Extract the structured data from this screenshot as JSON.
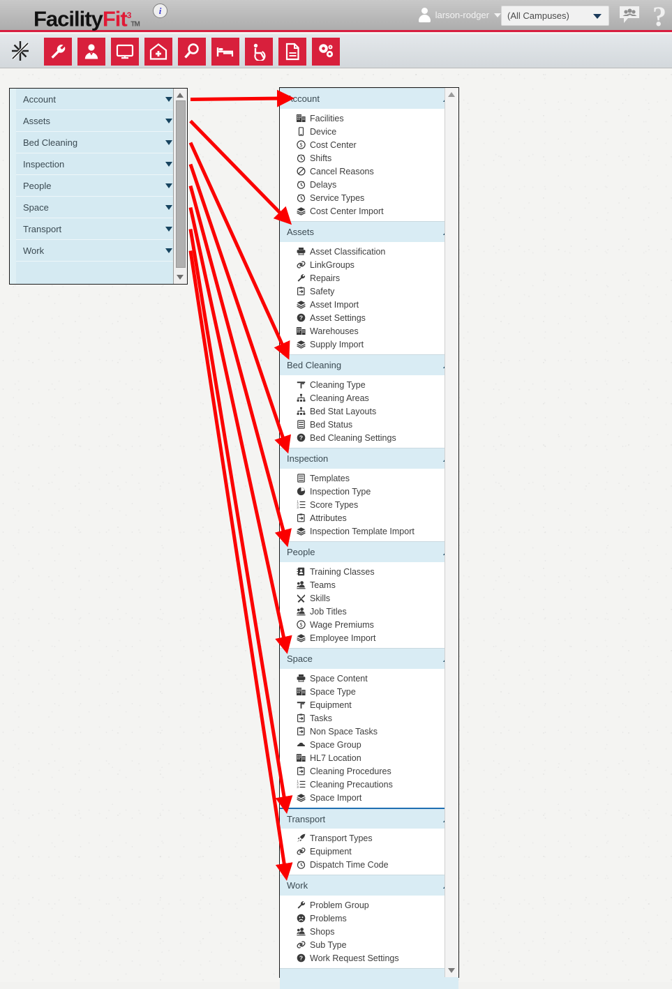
{
  "header": {
    "logo": {
      "part1": "Facility",
      "part2": "Fit",
      "sup": "3",
      "tm": "TM"
    },
    "info_badge": "i",
    "user_name": "larson-rodger",
    "campus_select_value": "(All Campuses)",
    "icons": {
      "avatar": "user-avatar-icon",
      "chat": "chat-bubble-icon",
      "help": "?"
    },
    "accent_color": "#d81e3f"
  },
  "toolbar": {
    "buttons": [
      {
        "name": "favorites-star-icon",
        "label": "Favorites"
      },
      {
        "name": "wrench-icon",
        "label": "Maintenance"
      },
      {
        "name": "person-icon",
        "label": "People"
      },
      {
        "name": "monitor-icon",
        "label": "Dashboard"
      },
      {
        "name": "hospital-home-icon",
        "label": "Facilities"
      },
      {
        "name": "magnifier-icon",
        "label": "Search"
      },
      {
        "name": "bed-icon",
        "label": "Bed Cleaning"
      },
      {
        "name": "wheelchair-icon",
        "label": "Transport"
      },
      {
        "name": "document-icon",
        "label": "Reports"
      },
      {
        "name": "gears-icon",
        "label": "Settings"
      }
    ]
  },
  "left_panel": {
    "rows": [
      {
        "label": "Account"
      },
      {
        "label": "Assets"
      },
      {
        "label": "Bed Cleaning"
      },
      {
        "label": "Inspection"
      },
      {
        "label": "People"
      },
      {
        "label": "Space"
      },
      {
        "label": "Transport"
      },
      {
        "label": "Work"
      }
    ]
  },
  "right_panel": {
    "sections": [
      {
        "title": "Account",
        "blue_top": false,
        "items": [
          {
            "icon": "building-icon",
            "label": "Facilities"
          },
          {
            "icon": "device-icon",
            "label": "Device"
          },
          {
            "icon": "dollar-circle-icon",
            "label": "Cost Center"
          },
          {
            "icon": "clock-icon",
            "label": "Shifts"
          },
          {
            "icon": "no-entry-icon",
            "label": "Cancel Reasons"
          },
          {
            "icon": "clock-icon",
            "label": "Delays"
          },
          {
            "icon": "clock-icon",
            "label": "Service Types"
          },
          {
            "icon": "layers-icon",
            "label": "Cost Center Import"
          }
        ]
      },
      {
        "title": "Assets",
        "blue_top": false,
        "items": [
          {
            "icon": "printer-icon",
            "label": "Asset Classification"
          },
          {
            "icon": "link-icon",
            "label": "LinkGroups"
          },
          {
            "icon": "wrench-icon",
            "label": "Repairs"
          },
          {
            "icon": "clipboard-icon",
            "label": "Safety"
          },
          {
            "icon": "layers-icon",
            "label": "Asset Import"
          },
          {
            "icon": "question-circle-icon",
            "label": "Asset Settings"
          },
          {
            "icon": "building-icon",
            "label": "Warehouses"
          },
          {
            "icon": "layers-icon",
            "label": "Supply Import"
          }
        ]
      },
      {
        "title": "Bed Cleaning",
        "blue_top": false,
        "items": [
          {
            "icon": "broom-icon",
            "label": "Cleaning Type"
          },
          {
            "icon": "hierarchy-icon",
            "label": "Cleaning Areas"
          },
          {
            "icon": "hierarchy-icon",
            "label": "Bed Stat Layouts"
          },
          {
            "icon": "list-panel-icon",
            "label": "Bed Status"
          },
          {
            "icon": "question-circle-icon",
            "label": "Bed Cleaning Settings"
          }
        ]
      },
      {
        "title": "Inspection",
        "blue_top": false,
        "items": [
          {
            "icon": "list-panel-icon",
            "label": "Templates"
          },
          {
            "icon": "pie-chart-icon",
            "label": "Inspection Type"
          },
          {
            "icon": "ordered-list-icon",
            "label": "Score Types"
          },
          {
            "icon": "clipboard-icon",
            "label": "Attributes"
          },
          {
            "icon": "layers-icon",
            "label": "Inspection Template Import"
          }
        ]
      },
      {
        "title": "People",
        "blue_top": false,
        "items": [
          {
            "icon": "address-book-icon",
            "label": "Training Classes"
          },
          {
            "icon": "people-icon",
            "label": "Teams"
          },
          {
            "icon": "tools-icon",
            "label": "Skills"
          },
          {
            "icon": "people-icon",
            "label": "Job Titles"
          },
          {
            "icon": "dollar-circle-icon",
            "label": "Wage Premiums"
          },
          {
            "icon": "layers-icon",
            "label": "Employee Import"
          }
        ]
      },
      {
        "title": "Space",
        "blue_top": false,
        "items": [
          {
            "icon": "printer-icon",
            "label": "Space Content"
          },
          {
            "icon": "building-icon",
            "label": "Space Type"
          },
          {
            "icon": "broom-icon",
            "label": "Equipment"
          },
          {
            "icon": "clipboard-icon",
            "label": "Tasks"
          },
          {
            "icon": "clipboard-icon",
            "label": "Non Space Tasks"
          },
          {
            "icon": "cloud-icon",
            "label": "Space Group"
          },
          {
            "icon": "building-icon",
            "label": "HL7 Location"
          },
          {
            "icon": "clipboard-icon",
            "label": "Cleaning Procedures"
          },
          {
            "icon": "ordered-list-icon",
            "label": "Cleaning Precautions"
          },
          {
            "icon": "layers-icon",
            "label": "Space Import"
          }
        ]
      },
      {
        "title": "Transport",
        "blue_top": true,
        "items": [
          {
            "icon": "rocket-icon",
            "label": "Transport Types"
          },
          {
            "icon": "link-icon",
            "label": "Equipment"
          },
          {
            "icon": "clock-icon",
            "label": "Dispatch Time Code"
          }
        ]
      },
      {
        "title": "Work",
        "blue_top": false,
        "items": [
          {
            "icon": "wrench-icon",
            "label": "Problem Group"
          },
          {
            "icon": "sad-face-icon",
            "label": "Problems"
          },
          {
            "icon": "people-icon",
            "label": "Shops"
          },
          {
            "icon": "link-icon",
            "label": "Sub Type"
          },
          {
            "icon": "question-circle-icon",
            "label": "Work Request Settings"
          }
        ]
      }
    ]
  },
  "annotations": {
    "arrow_color": "#fb0000",
    "arrows": [
      {
        "from_label": "Account",
        "to_label": "Account"
      },
      {
        "from_label": "Assets",
        "to_label": "Assets"
      },
      {
        "from_label": "Bed Cleaning",
        "to_label": "Bed Cleaning"
      },
      {
        "from_label": "Inspection",
        "to_label": "Inspection"
      },
      {
        "from_label": "People",
        "to_label": "People"
      },
      {
        "from_label": "Space",
        "to_label": "Space"
      },
      {
        "from_label": "Transport",
        "to_label": "Transport"
      },
      {
        "from_label": "Work",
        "to_label": "Work"
      }
    ]
  }
}
